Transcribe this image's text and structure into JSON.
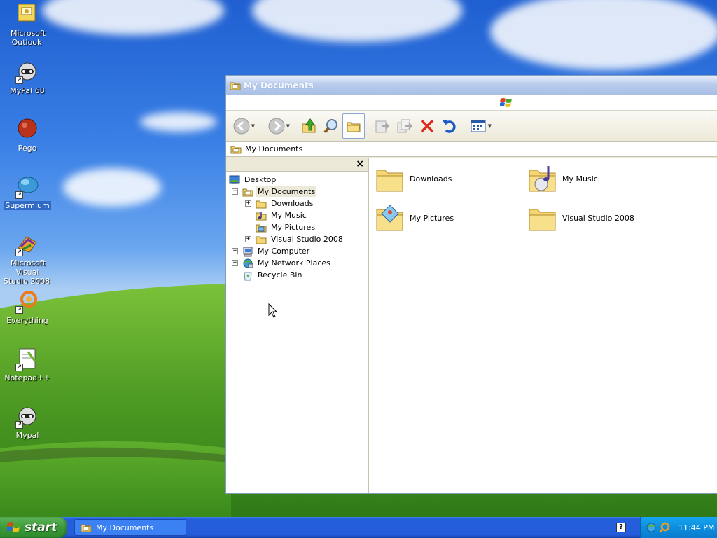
{
  "desktop": {
    "icons": [
      {
        "label": "Microsoft\nOutlook"
      },
      {
        "label": "MyPal 68"
      },
      {
        "label": "Pego"
      },
      {
        "label": "Supermium"
      },
      {
        "label": "Microsoft Visual\nStudio 2008"
      },
      {
        "label": "Everything"
      },
      {
        "label": "Notepad++"
      },
      {
        "label": "Mypal"
      }
    ]
  },
  "window": {
    "title": "My Documents",
    "address": "My Documents",
    "tree": [
      {
        "label": "Desktop",
        "icon": "desktop-icon"
      },
      {
        "label": "My Documents",
        "icon": "my-documents-icon",
        "expander": "−"
      },
      {
        "label": "Downloads",
        "icon": "folder-icon",
        "expander": "+"
      },
      {
        "label": "My Music",
        "icon": "music-folder-icon"
      },
      {
        "label": "My Pictures",
        "icon": "pictures-folder-icon"
      },
      {
        "label": "Visual Studio 2008",
        "icon": "folder-icon",
        "expander": "+"
      },
      {
        "label": "My Computer",
        "icon": "my-computer-icon",
        "expander": "+"
      },
      {
        "label": "My Network Places",
        "icon": "network-places-icon",
        "expander": "+"
      },
      {
        "label": "Recycle Bin",
        "icon": "recycle-bin-icon"
      }
    ],
    "files": [
      {
        "label": "Downloads",
        "icon": "folder-icon"
      },
      {
        "label": "My Music",
        "icon": "music-folder-icon"
      },
      {
        "label": "My Pictures",
        "icon": "pictures-folder-icon"
      },
      {
        "label": "Visual Studio 2008",
        "icon": "folder-icon"
      }
    ],
    "tree_close": "×"
  },
  "taskbar": {
    "start_label": "start",
    "task_label": "My Documents",
    "help_glyph": "?",
    "clock": "11:44 PM"
  },
  "colors": {
    "selection": "#316ac5",
    "taskbar": "#245edb",
    "start": "#3c9a3a",
    "tray": "#0d8ee0"
  }
}
